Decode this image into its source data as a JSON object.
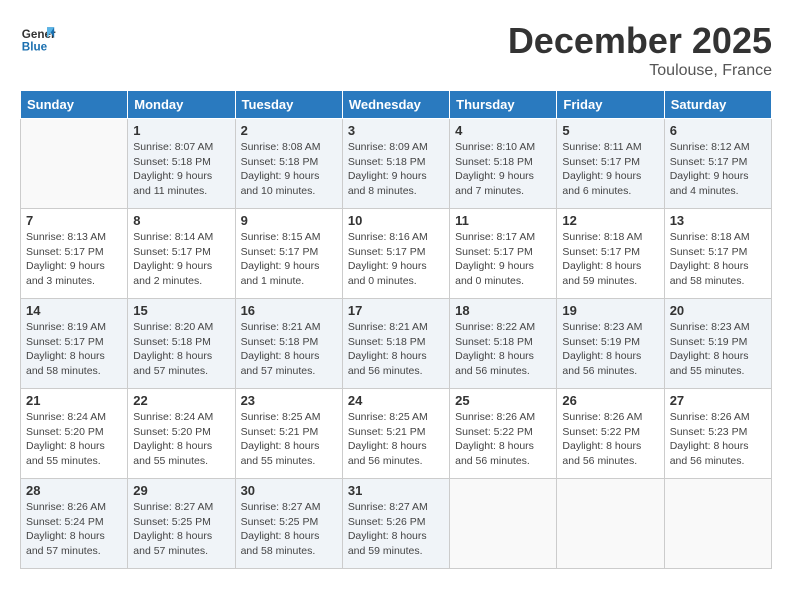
{
  "header": {
    "logo_general": "General",
    "logo_blue": "Blue",
    "month": "December 2025",
    "location": "Toulouse, France"
  },
  "days_of_week": [
    "Sunday",
    "Monday",
    "Tuesday",
    "Wednesday",
    "Thursday",
    "Friday",
    "Saturday"
  ],
  "weeks": [
    [
      {
        "day": "",
        "info": ""
      },
      {
        "day": "1",
        "info": "Sunrise: 8:07 AM\nSunset: 5:18 PM\nDaylight: 9 hours\nand 11 minutes."
      },
      {
        "day": "2",
        "info": "Sunrise: 8:08 AM\nSunset: 5:18 PM\nDaylight: 9 hours\nand 10 minutes."
      },
      {
        "day": "3",
        "info": "Sunrise: 8:09 AM\nSunset: 5:18 PM\nDaylight: 9 hours\nand 8 minutes."
      },
      {
        "day": "4",
        "info": "Sunrise: 8:10 AM\nSunset: 5:18 PM\nDaylight: 9 hours\nand 7 minutes."
      },
      {
        "day": "5",
        "info": "Sunrise: 8:11 AM\nSunset: 5:17 PM\nDaylight: 9 hours\nand 6 minutes."
      },
      {
        "day": "6",
        "info": "Sunrise: 8:12 AM\nSunset: 5:17 PM\nDaylight: 9 hours\nand 4 minutes."
      }
    ],
    [
      {
        "day": "7",
        "info": "Sunrise: 8:13 AM\nSunset: 5:17 PM\nDaylight: 9 hours\nand 3 minutes."
      },
      {
        "day": "8",
        "info": "Sunrise: 8:14 AM\nSunset: 5:17 PM\nDaylight: 9 hours\nand 2 minutes."
      },
      {
        "day": "9",
        "info": "Sunrise: 8:15 AM\nSunset: 5:17 PM\nDaylight: 9 hours\nand 1 minute."
      },
      {
        "day": "10",
        "info": "Sunrise: 8:16 AM\nSunset: 5:17 PM\nDaylight: 9 hours\nand 0 minutes."
      },
      {
        "day": "11",
        "info": "Sunrise: 8:17 AM\nSunset: 5:17 PM\nDaylight: 9 hours\nand 0 minutes."
      },
      {
        "day": "12",
        "info": "Sunrise: 8:18 AM\nSunset: 5:17 PM\nDaylight: 8 hours\nand 59 minutes."
      },
      {
        "day": "13",
        "info": "Sunrise: 8:18 AM\nSunset: 5:17 PM\nDaylight: 8 hours\nand 58 minutes."
      }
    ],
    [
      {
        "day": "14",
        "info": "Sunrise: 8:19 AM\nSunset: 5:17 PM\nDaylight: 8 hours\nand 58 minutes."
      },
      {
        "day": "15",
        "info": "Sunrise: 8:20 AM\nSunset: 5:18 PM\nDaylight: 8 hours\nand 57 minutes."
      },
      {
        "day": "16",
        "info": "Sunrise: 8:21 AM\nSunset: 5:18 PM\nDaylight: 8 hours\nand 57 minutes."
      },
      {
        "day": "17",
        "info": "Sunrise: 8:21 AM\nSunset: 5:18 PM\nDaylight: 8 hours\nand 56 minutes."
      },
      {
        "day": "18",
        "info": "Sunrise: 8:22 AM\nSunset: 5:18 PM\nDaylight: 8 hours\nand 56 minutes."
      },
      {
        "day": "19",
        "info": "Sunrise: 8:23 AM\nSunset: 5:19 PM\nDaylight: 8 hours\nand 56 minutes."
      },
      {
        "day": "20",
        "info": "Sunrise: 8:23 AM\nSunset: 5:19 PM\nDaylight: 8 hours\nand 55 minutes."
      }
    ],
    [
      {
        "day": "21",
        "info": "Sunrise: 8:24 AM\nSunset: 5:20 PM\nDaylight: 8 hours\nand 55 minutes."
      },
      {
        "day": "22",
        "info": "Sunrise: 8:24 AM\nSunset: 5:20 PM\nDaylight: 8 hours\nand 55 minutes."
      },
      {
        "day": "23",
        "info": "Sunrise: 8:25 AM\nSunset: 5:21 PM\nDaylight: 8 hours\nand 55 minutes."
      },
      {
        "day": "24",
        "info": "Sunrise: 8:25 AM\nSunset: 5:21 PM\nDaylight: 8 hours\nand 56 minutes."
      },
      {
        "day": "25",
        "info": "Sunrise: 8:26 AM\nSunset: 5:22 PM\nDaylight: 8 hours\nand 56 minutes."
      },
      {
        "day": "26",
        "info": "Sunrise: 8:26 AM\nSunset: 5:22 PM\nDaylight: 8 hours\nand 56 minutes."
      },
      {
        "day": "27",
        "info": "Sunrise: 8:26 AM\nSunset: 5:23 PM\nDaylight: 8 hours\nand 56 minutes."
      }
    ],
    [
      {
        "day": "28",
        "info": "Sunrise: 8:26 AM\nSunset: 5:24 PM\nDaylight: 8 hours\nand 57 minutes."
      },
      {
        "day": "29",
        "info": "Sunrise: 8:27 AM\nSunset: 5:25 PM\nDaylight: 8 hours\nand 57 minutes."
      },
      {
        "day": "30",
        "info": "Sunrise: 8:27 AM\nSunset: 5:25 PM\nDaylight: 8 hours\nand 58 minutes."
      },
      {
        "day": "31",
        "info": "Sunrise: 8:27 AM\nSunset: 5:26 PM\nDaylight: 8 hours\nand 59 minutes."
      },
      {
        "day": "",
        "info": ""
      },
      {
        "day": "",
        "info": ""
      },
      {
        "day": "",
        "info": ""
      }
    ]
  ]
}
